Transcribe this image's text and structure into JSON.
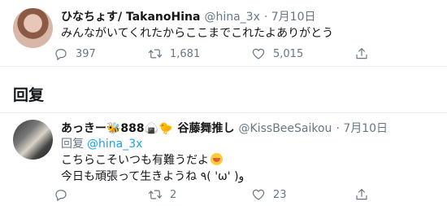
{
  "tweet_main": {
    "display_name": "ひなちょす/ TakanoHina",
    "handle": "@hina_3x",
    "date": "· 7月10日",
    "text": "みんながいてくれたからここまでこれたよありがとう",
    "replies": "397",
    "retweets": "1,681",
    "likes": "5,015"
  },
  "section": {
    "title": "回复"
  },
  "tweet_reply": {
    "display_name": "あっきー🐝888🍙🐤",
    "display_name_suffix": "谷藤舞推し",
    "handle": "@KissBeeSaikou",
    "date": "· 7月10日",
    "reply_label": "回复",
    "reply_handle": "@hina_3x",
    "line1": "こちらこそいつも有難うだよ",
    "line2": "今日も頑張って生きようね ٩( 'ω' )و",
    "replies": "",
    "retweets": "2",
    "likes": "23"
  },
  "icons": {
    "reply": "reply-icon",
    "retweet": "retweet-icon",
    "like": "heart-icon",
    "share": "share-icon"
  },
  "colors": {
    "text": "#14171a",
    "secondary": "#657786",
    "link": "#1da1f2",
    "divider": "#e6ecf0"
  }
}
